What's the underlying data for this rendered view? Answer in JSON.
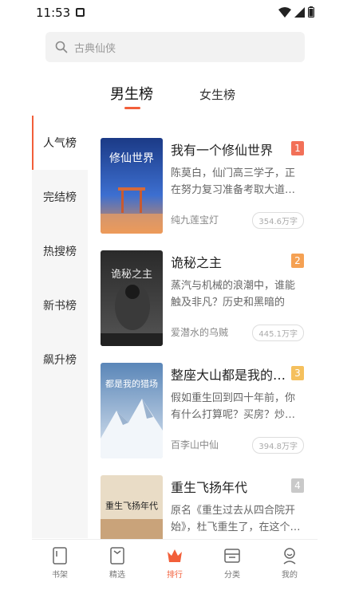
{
  "status": {
    "time": "11:53"
  },
  "search": {
    "placeholder": "古典仙侠"
  },
  "tabs": {
    "male": "男生榜",
    "female": "女生榜"
  },
  "sidebar": {
    "items": [
      {
        "label": "人气榜"
      },
      {
        "label": "完结榜"
      },
      {
        "label": "热搜榜"
      },
      {
        "label": "新书榜"
      },
      {
        "label": "飙升榜"
      }
    ]
  },
  "books": [
    {
      "title": "我有一个修仙世界",
      "desc": "陈莫白，仙门高三学子，正在努力复习准备考取大道…",
      "author": "纯九莲宝灯",
      "words": "354.6万字",
      "rank": "1",
      "rank_color": "#f27058",
      "cover_text": "修仙世界"
    },
    {
      "title": "诡秘之主",
      "desc": "蒸汽与机械的浪潮中，谁能触及非凡？历史和黑暗的迷…",
      "author": "爱潜水的乌贼",
      "words": "445.1万字",
      "rank": "2",
      "rank_color": "#f5a153",
      "cover_text": "诡秘之主"
    },
    {
      "title": "整座大山都是我的…",
      "desc": "假如重生回到四十年前，你有什么打算呢？买房？炒…",
      "author": "百李山中仙",
      "words": "394.8万字",
      "rank": "3",
      "rank_color": "#f5c05d",
      "cover_text": "都是我的猎场"
    },
    {
      "title": "重生飞扬年代",
      "desc": "原名《重生过去从四合院开始》，杜飞重生了，在这个…",
      "author": "",
      "words": "",
      "rank": "4",
      "rank_color": "#c9c9c9",
      "cover_text": "重生飞扬年代"
    }
  ],
  "nav": {
    "items": [
      {
        "label": "书架"
      },
      {
        "label": "精选"
      },
      {
        "label": "排行"
      },
      {
        "label": "分类"
      },
      {
        "label": "我的"
      }
    ]
  }
}
